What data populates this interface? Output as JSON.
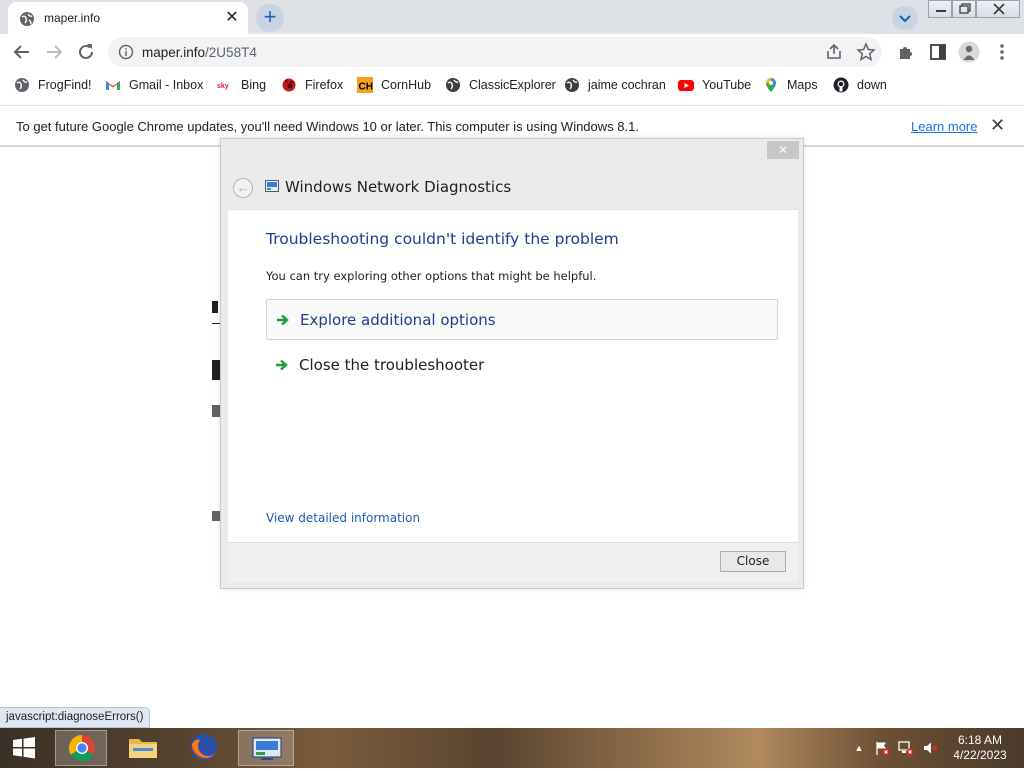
{
  "browser": {
    "tab": {
      "title": "maper.info",
      "close": "✕"
    },
    "new_tab": "+",
    "address": {
      "domain": "maper.info",
      "path": "/2U58T4"
    }
  },
  "bookmarks": [
    {
      "label": "FrogFind!",
      "icon": "globe-icon"
    },
    {
      "label": "Gmail - Inbox",
      "icon": "gmail-icon"
    },
    {
      "label": "Bing",
      "icon": "bing-icon"
    },
    {
      "label": "Firefox",
      "icon": "firefox-icon"
    },
    {
      "label": "CornHub",
      "icon": "cornhub-icon",
      "icon_text": "CH"
    },
    {
      "label": "ClassicExplorer",
      "icon": "globe-icon"
    },
    {
      "label": "jaime cochran",
      "icon": "globe-icon"
    },
    {
      "label": "YouTube",
      "icon": "youtube-icon"
    },
    {
      "label": "Maps",
      "icon": "maps-icon"
    },
    {
      "label": "down",
      "icon": "github-icon"
    }
  ],
  "infobar": {
    "message": "To get future Google Chrome updates, you'll need Windows 10 or later. This computer is using Windows 8.1.",
    "link": "Learn more",
    "close": "✕"
  },
  "dialog": {
    "window_title": "Windows Network Diagnostics",
    "close_x": "✕",
    "back": "←",
    "heading": "Troubleshooting couldn't identify the problem",
    "subtext": "You can try exploring other options that might be helpful.",
    "options": [
      {
        "label": "Explore additional options"
      },
      {
        "label": "Close the troubleshooter"
      }
    ],
    "detail_link": "View detailed information",
    "close_button": "Close"
  },
  "status_bar": "javascript:diagnoseErrors()",
  "taskbar": {
    "time": "6:18 AM",
    "date": "4/22/2023",
    "tray_arrow": "▲"
  },
  "colors": {
    "dialog_heading": "#1b3f8b",
    "link_blue": "#1a5cb5",
    "chrome_accent": "#1a73e8",
    "arrow_green": "#1f9d3a"
  }
}
